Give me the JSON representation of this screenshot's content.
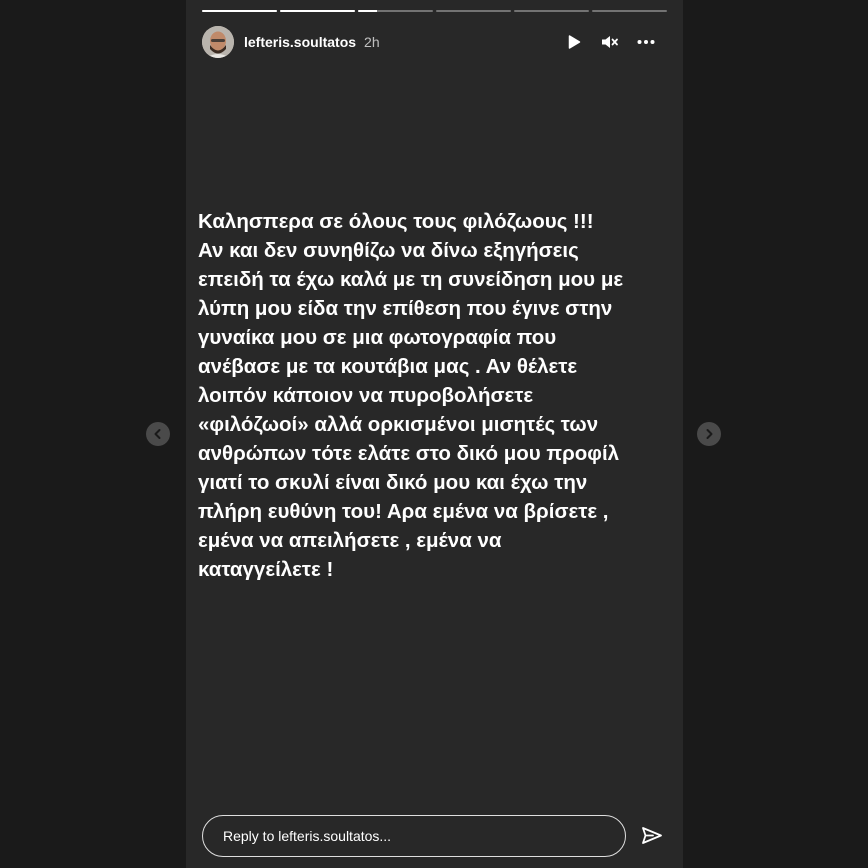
{
  "story": {
    "username": "lefteris.soultatos",
    "time": "2h",
    "progress_segments": [
      1,
      1,
      0.25,
      0,
      0,
      0
    ],
    "text": "Καλησπερα σε όλους τους φιλόζωους !!!\nΑν και δεν συνηθίζω να δίνω εξηγήσεις\nεπειδή τα έχω καλά με τη συνείδηση μου με\nλύπη μου είδα την επίθεση που έγινε στην\nγυναίκα μου σε μια φωτογραφία που\nανέβασε με τα κουτάβια μας . Αν θέλετε\nλοιπόν κάποιον να πυροβολήσετε\n«φιλόζωοί» αλλά ορκισμένοι μισητές των\nανθρώπων τότε ελάτε στο δικό μου προφίλ\nγιατί το σκυλί είναι δικό μου και έχω την\nπλήρη ευθύνη του! Αρα εμένα να βρίσετε ,\nεμένα να απειλήσετε , εμένα να\nκαταγγείλετε !"
  },
  "icons": {
    "play": "play-icon",
    "mute": "mute-icon",
    "more": "more-icon",
    "prev": "chevron-left-icon",
    "next": "chevron-right-icon",
    "send": "send-icon"
  },
  "reply": {
    "placeholder": "Reply to lefteris.soultatos..."
  },
  "colors": {
    "page_bg": "#1a1a1a",
    "story_bg": "#282828",
    "text": "#ffffff"
  }
}
